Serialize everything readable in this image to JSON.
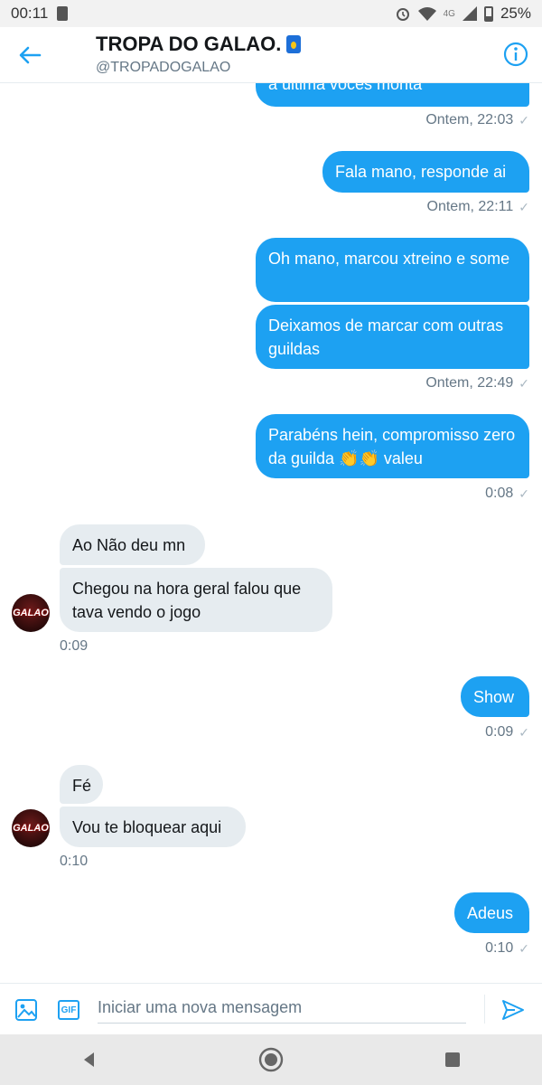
{
  "status": {
    "time": "00:11",
    "network": "4G",
    "battery": "25%"
  },
  "header": {
    "title": "TROPA DO GALAO.",
    "handle": "@TROPADOGALAO"
  },
  "avatar_text": "GALAO",
  "messages": {
    "m0": {
      "text": "a última vocês monta",
      "time": "Ontem, 22:03"
    },
    "m1": {
      "text": "Fala mano, responde ai",
      "time": "Ontem, 22:11"
    },
    "m2a": {
      "text": "Oh mano, marcou xtreino e some"
    },
    "m2b": {
      "text": "Deixamos de marcar com outras guildas",
      "time": "Ontem, 22:49"
    },
    "m3": {
      "text": "Parabéns hein, compromisso zero da guilda 👏👏 valeu",
      "time": "0:08"
    },
    "r1a": {
      "text": "Ao Não deu mn"
    },
    "r1b": {
      "text": "Chegou na hora geral falou que tava vendo o jogo",
      "time": "0:09"
    },
    "m4": {
      "text": "Show",
      "time": "0:09"
    },
    "r2a": {
      "text": "Fé"
    },
    "r2b": {
      "text": "Vou te bloquear aqui",
      "time": "0:10"
    },
    "m5": {
      "text": "Adeus",
      "time": "0:10"
    }
  },
  "composer": {
    "placeholder": "Iniciar uma nova mensagem",
    "gif_label": "GIF"
  },
  "check_glyph": "✓",
  "colors": {
    "accent": "#1da1f2",
    "incoming_bubble": "#e6ecf0",
    "meta_text": "#657786"
  }
}
